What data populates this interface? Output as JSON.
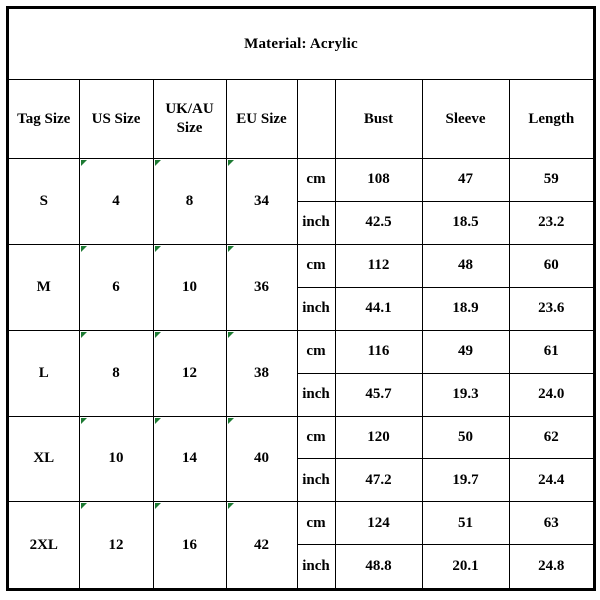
{
  "title": "Material: Acrylic",
  "headers": {
    "tag_size": "Tag Size",
    "us_size": "US Size",
    "uk_au_size_line1": "UK/AU",
    "uk_au_size_line2": "Size",
    "eu_size": "EU Size",
    "unit": "",
    "bust": "Bust",
    "sleeve": "Sleeve",
    "length": "Length"
  },
  "units": {
    "cm": "cm",
    "inch": "inch"
  },
  "colors": {
    "inch_row_background": "#c0c0c0",
    "border": "#000000",
    "page_background": "#ffffff",
    "note_marker": "#1d7a33"
  },
  "rows": [
    {
      "tag_size": "S",
      "us_size": "4",
      "uk_au_size": "8",
      "eu_size": "34",
      "cm": {
        "bust": "108",
        "sleeve": "47",
        "length": "59"
      },
      "inch": {
        "bust": "42.5",
        "sleeve": "18.5",
        "length": "23.2"
      }
    },
    {
      "tag_size": "M",
      "us_size": "6",
      "uk_au_size": "10",
      "eu_size": "36",
      "cm": {
        "bust": "112",
        "sleeve": "48",
        "length": "60"
      },
      "inch": {
        "bust": "44.1",
        "sleeve": "18.9",
        "length": "23.6"
      }
    },
    {
      "tag_size": "L",
      "us_size": "8",
      "uk_au_size": "12",
      "eu_size": "38",
      "cm": {
        "bust": "116",
        "sleeve": "49",
        "length": "61"
      },
      "inch": {
        "bust": "45.7",
        "sleeve": "19.3",
        "length": "24.0"
      }
    },
    {
      "tag_size": "XL",
      "us_size": "10",
      "uk_au_size": "14",
      "eu_size": "40",
      "cm": {
        "bust": "120",
        "sleeve": "50",
        "length": "62"
      },
      "inch": {
        "bust": "47.2",
        "sleeve": "19.7",
        "length": "24.4"
      }
    },
    {
      "tag_size": "2XL",
      "us_size": "12",
      "uk_au_size": "16",
      "eu_size": "42",
      "cm": {
        "bust": "124",
        "sleeve": "51",
        "length": "63"
      },
      "inch": {
        "bust": "48.8",
        "sleeve": "20.1",
        "length": "24.8"
      }
    }
  ]
}
